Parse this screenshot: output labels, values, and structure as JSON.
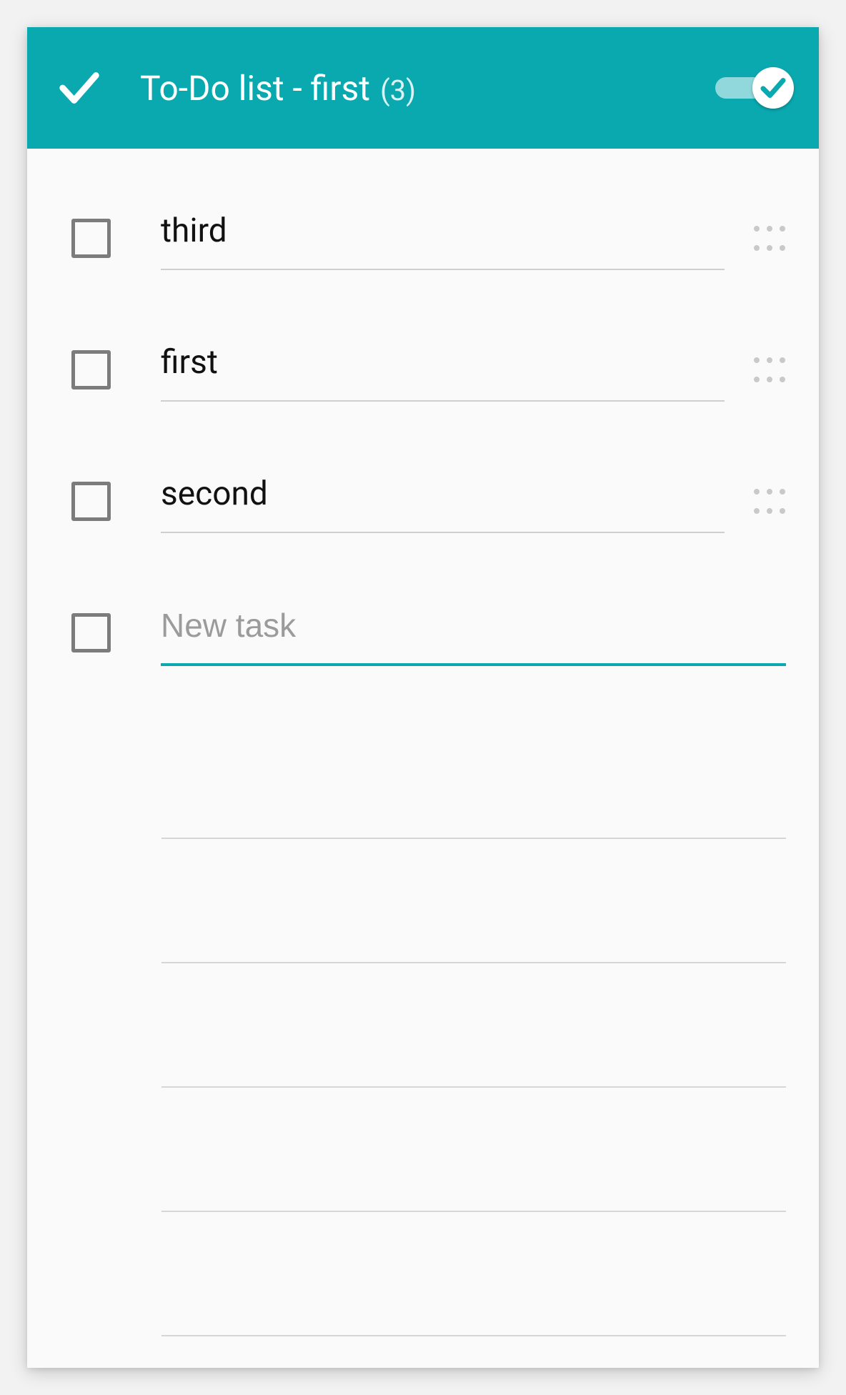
{
  "header": {
    "title": "To-Do list - first",
    "count_fmt": "(3)",
    "toggle_on": true
  },
  "tasks": [
    {
      "label": "third",
      "done": false
    },
    {
      "label": "first",
      "done": false
    },
    {
      "label": "second",
      "done": false
    }
  ],
  "new_task": {
    "placeholder": "New task",
    "value": ""
  },
  "colors": {
    "accent": "#0aa9b0"
  }
}
